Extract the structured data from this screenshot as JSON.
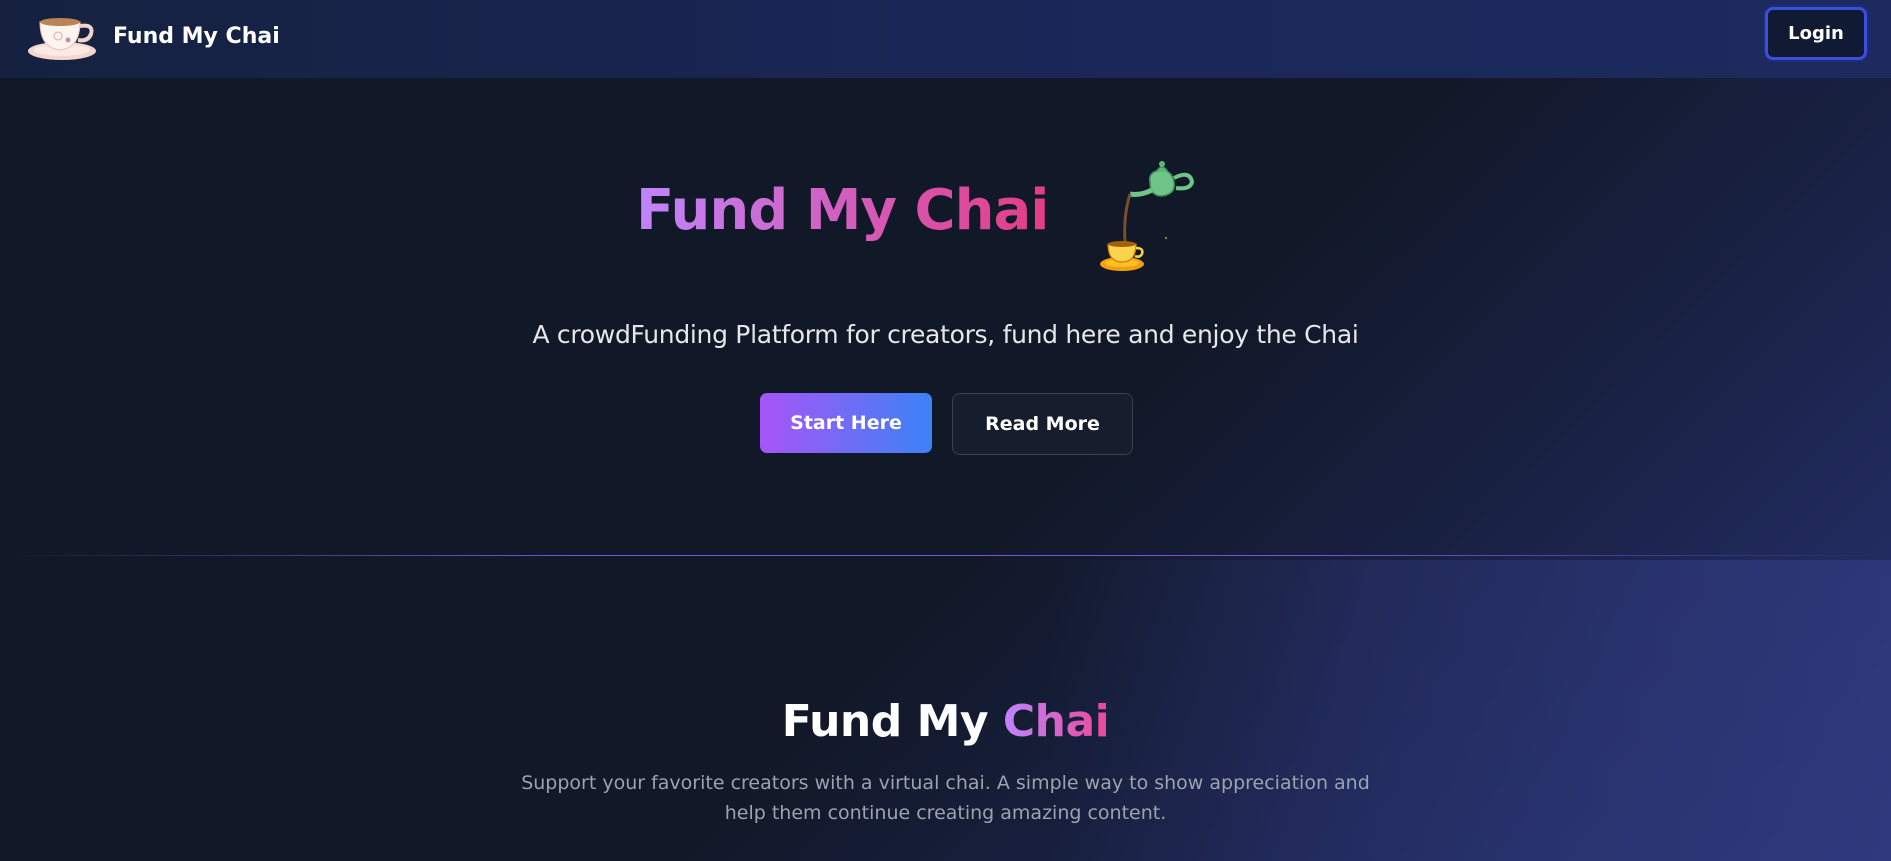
{
  "nav": {
    "brand": "Fund My Chai",
    "logo_icon": "teacup-icon",
    "login_label": "Login"
  },
  "hero": {
    "title": "Fund My Chai",
    "illustration_icon": "teapot-pouring-icon",
    "tagline": "A crowdFunding Platform for creators, fund here and enjoy the Chai",
    "start_label": "Start Here",
    "read_label": "Read More"
  },
  "section": {
    "title_prefix": "Fund My",
    "title_accent": "Chai",
    "description": "Support your favorite creators with a virtual chai. A simple way to show appreciation and help them continue creating amazing content."
  },
  "colors": {
    "background": "#111827",
    "nav_background": "#1a2656",
    "gradient_start": "#a855f7",
    "gradient_end": "#3b82f6",
    "title_gradient_start": "#c084fc",
    "title_gradient_end": "#ec4899",
    "login_border": "#3b4fd8"
  }
}
